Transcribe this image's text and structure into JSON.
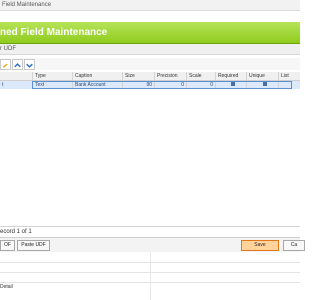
{
  "window": {
    "title": "Field Maintenance"
  },
  "header": {
    "title": "ned Field Maintenance"
  },
  "subheader": {
    "text": "r UDF"
  },
  "toolbar": {
    "buttons": [
      {
        "name": "edit-pencil-icon"
      },
      {
        "name": "move-up-icon"
      },
      {
        "name": "move-down-icon"
      }
    ]
  },
  "grid": {
    "columns": [
      "Type",
      "Caption",
      "Size",
      "Precision",
      "Scale",
      "Required",
      "Unique",
      "List"
    ],
    "rows": [
      {
        "name_fragment": "t",
        "type": "Text",
        "caption": "Bank Account",
        "size": "90",
        "precision": "0",
        "scale": "0",
        "required": true,
        "unique": true
      }
    ]
  },
  "pager": {
    "text": "ecord 1 of 1"
  },
  "buttons": {
    "left1": "OF",
    "left2": "Paste UDF",
    "save": "Save",
    "right": "Ca"
  },
  "lower": {
    "detail_label": "Detail"
  },
  "colors": {
    "header_green": "#8fcc1d",
    "save_orange": "#ffd39a",
    "row_select": "#dbe9fb"
  }
}
